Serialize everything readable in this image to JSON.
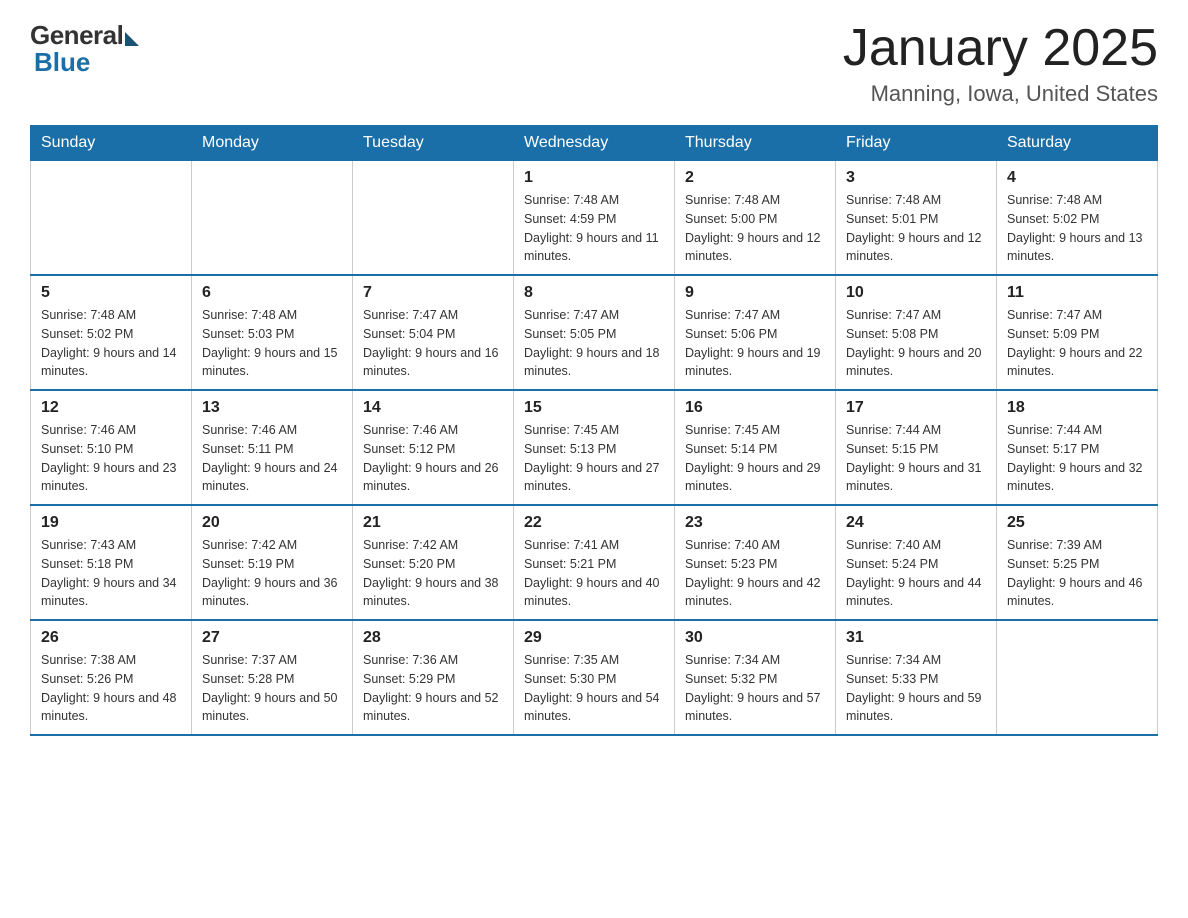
{
  "logo": {
    "general": "General",
    "blue": "Blue"
  },
  "header": {
    "month": "January 2025",
    "location": "Manning, Iowa, United States"
  },
  "days_of_week": [
    "Sunday",
    "Monday",
    "Tuesday",
    "Wednesday",
    "Thursday",
    "Friday",
    "Saturday"
  ],
  "weeks": [
    [
      {
        "day": "",
        "info": ""
      },
      {
        "day": "",
        "info": ""
      },
      {
        "day": "",
        "info": ""
      },
      {
        "day": "1",
        "info": "Sunrise: 7:48 AM\nSunset: 4:59 PM\nDaylight: 9 hours and 11 minutes."
      },
      {
        "day": "2",
        "info": "Sunrise: 7:48 AM\nSunset: 5:00 PM\nDaylight: 9 hours and 12 minutes."
      },
      {
        "day": "3",
        "info": "Sunrise: 7:48 AM\nSunset: 5:01 PM\nDaylight: 9 hours and 12 minutes."
      },
      {
        "day": "4",
        "info": "Sunrise: 7:48 AM\nSunset: 5:02 PM\nDaylight: 9 hours and 13 minutes."
      }
    ],
    [
      {
        "day": "5",
        "info": "Sunrise: 7:48 AM\nSunset: 5:02 PM\nDaylight: 9 hours and 14 minutes."
      },
      {
        "day": "6",
        "info": "Sunrise: 7:48 AM\nSunset: 5:03 PM\nDaylight: 9 hours and 15 minutes."
      },
      {
        "day": "7",
        "info": "Sunrise: 7:47 AM\nSunset: 5:04 PM\nDaylight: 9 hours and 16 minutes."
      },
      {
        "day": "8",
        "info": "Sunrise: 7:47 AM\nSunset: 5:05 PM\nDaylight: 9 hours and 18 minutes."
      },
      {
        "day": "9",
        "info": "Sunrise: 7:47 AM\nSunset: 5:06 PM\nDaylight: 9 hours and 19 minutes."
      },
      {
        "day": "10",
        "info": "Sunrise: 7:47 AM\nSunset: 5:08 PM\nDaylight: 9 hours and 20 minutes."
      },
      {
        "day": "11",
        "info": "Sunrise: 7:47 AM\nSunset: 5:09 PM\nDaylight: 9 hours and 22 minutes."
      }
    ],
    [
      {
        "day": "12",
        "info": "Sunrise: 7:46 AM\nSunset: 5:10 PM\nDaylight: 9 hours and 23 minutes."
      },
      {
        "day": "13",
        "info": "Sunrise: 7:46 AM\nSunset: 5:11 PM\nDaylight: 9 hours and 24 minutes."
      },
      {
        "day": "14",
        "info": "Sunrise: 7:46 AM\nSunset: 5:12 PM\nDaylight: 9 hours and 26 minutes."
      },
      {
        "day": "15",
        "info": "Sunrise: 7:45 AM\nSunset: 5:13 PM\nDaylight: 9 hours and 27 minutes."
      },
      {
        "day": "16",
        "info": "Sunrise: 7:45 AM\nSunset: 5:14 PM\nDaylight: 9 hours and 29 minutes."
      },
      {
        "day": "17",
        "info": "Sunrise: 7:44 AM\nSunset: 5:15 PM\nDaylight: 9 hours and 31 minutes."
      },
      {
        "day": "18",
        "info": "Sunrise: 7:44 AM\nSunset: 5:17 PM\nDaylight: 9 hours and 32 minutes."
      }
    ],
    [
      {
        "day": "19",
        "info": "Sunrise: 7:43 AM\nSunset: 5:18 PM\nDaylight: 9 hours and 34 minutes."
      },
      {
        "day": "20",
        "info": "Sunrise: 7:42 AM\nSunset: 5:19 PM\nDaylight: 9 hours and 36 minutes."
      },
      {
        "day": "21",
        "info": "Sunrise: 7:42 AM\nSunset: 5:20 PM\nDaylight: 9 hours and 38 minutes."
      },
      {
        "day": "22",
        "info": "Sunrise: 7:41 AM\nSunset: 5:21 PM\nDaylight: 9 hours and 40 minutes."
      },
      {
        "day": "23",
        "info": "Sunrise: 7:40 AM\nSunset: 5:23 PM\nDaylight: 9 hours and 42 minutes."
      },
      {
        "day": "24",
        "info": "Sunrise: 7:40 AM\nSunset: 5:24 PM\nDaylight: 9 hours and 44 minutes."
      },
      {
        "day": "25",
        "info": "Sunrise: 7:39 AM\nSunset: 5:25 PM\nDaylight: 9 hours and 46 minutes."
      }
    ],
    [
      {
        "day": "26",
        "info": "Sunrise: 7:38 AM\nSunset: 5:26 PM\nDaylight: 9 hours and 48 minutes."
      },
      {
        "day": "27",
        "info": "Sunrise: 7:37 AM\nSunset: 5:28 PM\nDaylight: 9 hours and 50 minutes."
      },
      {
        "day": "28",
        "info": "Sunrise: 7:36 AM\nSunset: 5:29 PM\nDaylight: 9 hours and 52 minutes."
      },
      {
        "day": "29",
        "info": "Sunrise: 7:35 AM\nSunset: 5:30 PM\nDaylight: 9 hours and 54 minutes."
      },
      {
        "day": "30",
        "info": "Sunrise: 7:34 AM\nSunset: 5:32 PM\nDaylight: 9 hours and 57 minutes."
      },
      {
        "day": "31",
        "info": "Sunrise: 7:34 AM\nSunset: 5:33 PM\nDaylight: 9 hours and 59 minutes."
      },
      {
        "day": "",
        "info": ""
      }
    ]
  ]
}
